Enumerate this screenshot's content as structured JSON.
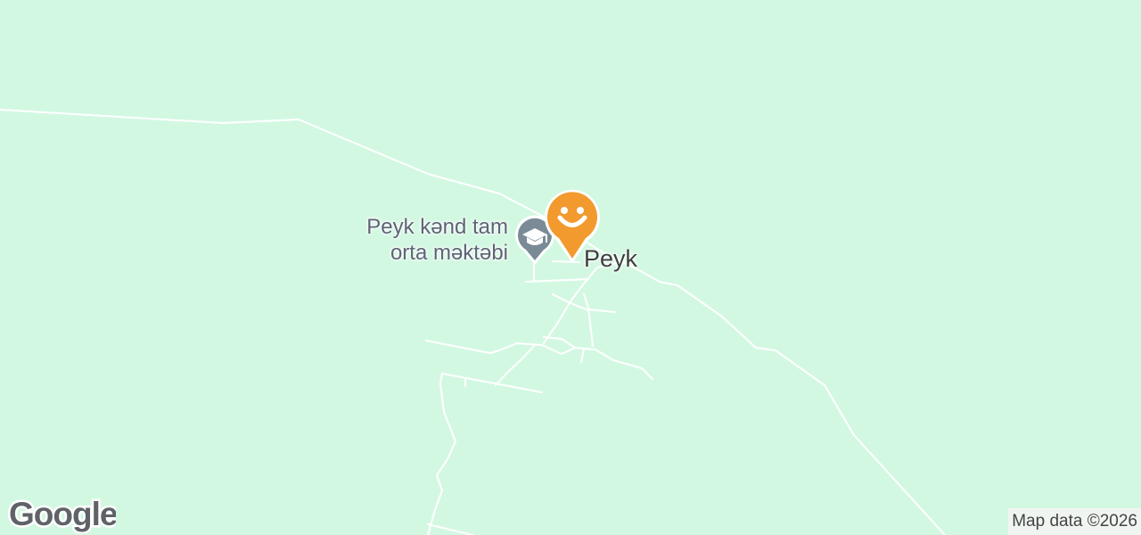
{
  "map": {
    "background_color": "#d3f8e2",
    "road_color": "#ffffff",
    "accent_color": "#f29a2e",
    "poi_icon_color": "#7b8a97"
  },
  "poi": {
    "label_line1": "Peyk kənd tam",
    "label_line2": "orta məktəbi",
    "icon": "school-icon"
  },
  "place": {
    "label": "Peyk",
    "pin_icon": "smiley-location-pin-icon"
  },
  "branding": {
    "logo": "Google"
  },
  "attribution": "Map data ©2026"
}
